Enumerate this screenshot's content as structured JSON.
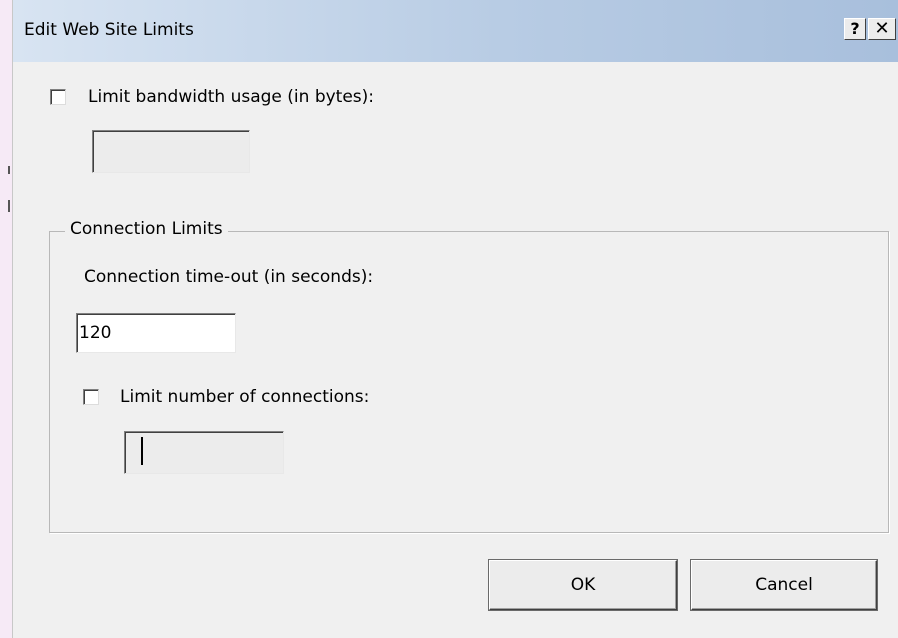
{
  "window": {
    "title": "Edit Web Site Limits",
    "help_label": "?",
    "close_label": "✕"
  },
  "bandwidth": {
    "checkbox_checked": false,
    "label": "Limit bandwidth usage (in bytes):",
    "value": ""
  },
  "connection_limits": {
    "group_title": "Connection Limits",
    "timeout_label": "Connection time-out (in seconds):",
    "timeout_value": "120",
    "limit_checkbox_checked": false,
    "limit_label": "Limit number of connections:",
    "limit_value": ""
  },
  "buttons": {
    "ok": "OK",
    "cancel": "Cancel"
  }
}
